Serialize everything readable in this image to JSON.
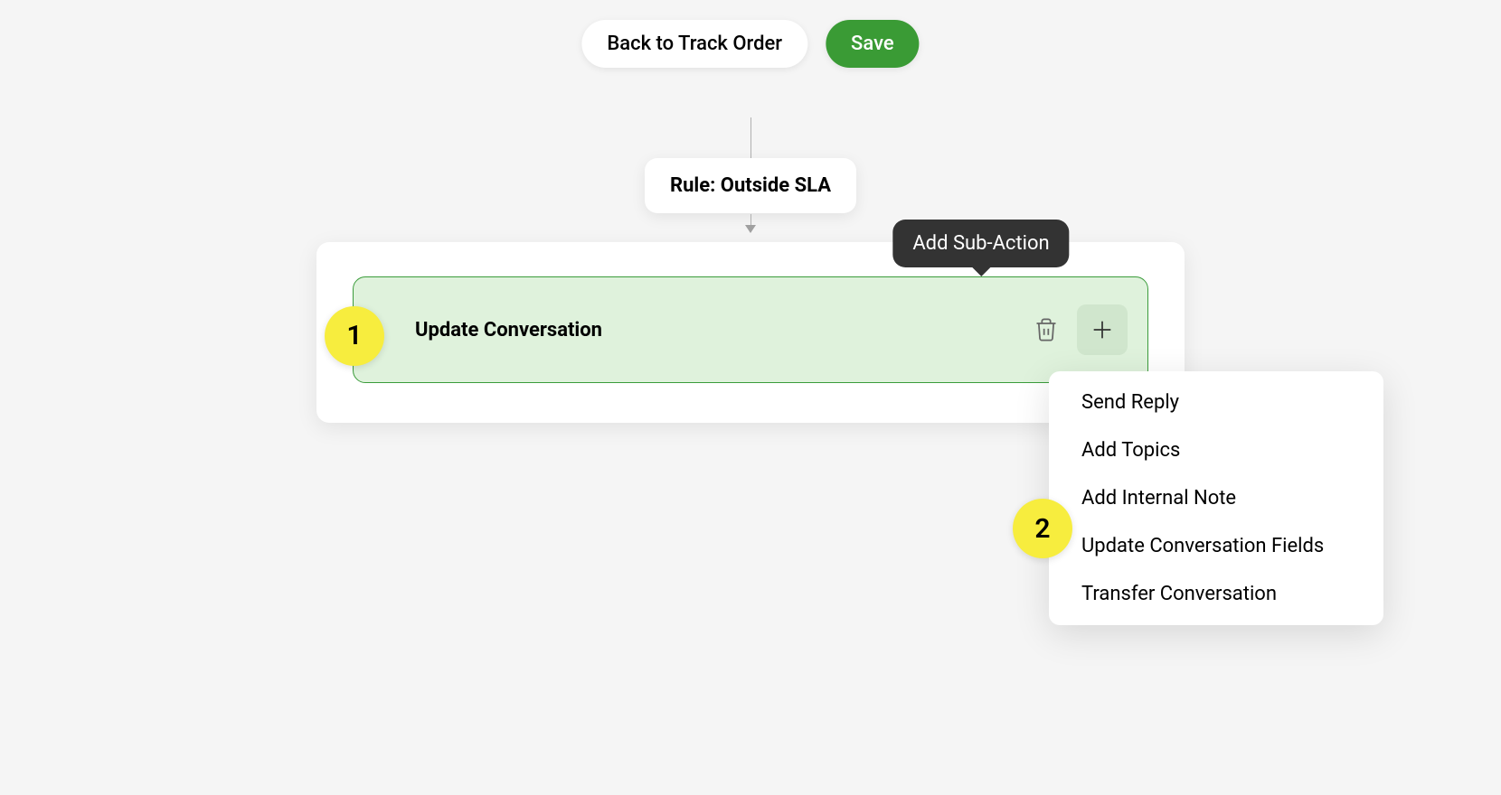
{
  "toolbar": {
    "back_label": "Back to Track Order",
    "save_label": "Save"
  },
  "rule": {
    "label": "Rule: Outside SLA"
  },
  "action": {
    "title": "Update Conversation"
  },
  "tooltip": {
    "add_sub_action": "Add Sub-Action"
  },
  "menu": {
    "items": [
      "Send Reply",
      "Add Topics",
      "Add Internal Note",
      "Update Conversation Fields",
      "Transfer Conversation"
    ]
  },
  "badges": {
    "one": "1",
    "two": "2"
  }
}
